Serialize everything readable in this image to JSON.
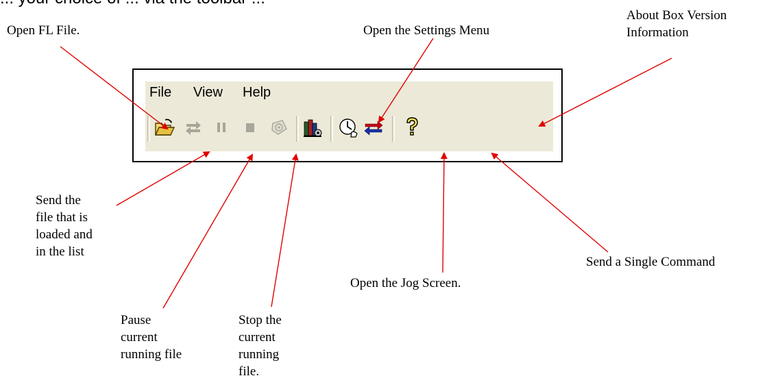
{
  "heading_fragment": "... your choice of ... via the toolbar ...",
  "menu": {
    "file": "File",
    "view": "View",
    "help": "Help"
  },
  "toolbar_buttons": [
    {
      "name": "open-fl-file-button",
      "icon": "open-folder-icon",
      "enabled": true
    },
    {
      "name": "send-file-button",
      "icon": "send-arrows-icon",
      "enabled": false
    },
    {
      "name": "pause-button",
      "icon": "pause-icon",
      "enabled": false
    },
    {
      "name": "stop-button",
      "icon": "stop-icon",
      "enabled": false
    },
    {
      "name": "disabled-tool-button",
      "icon": "gear-disc-icon",
      "enabled": false
    },
    {
      "name": "settings-button",
      "icon": "settings-books-icon",
      "enabled": true
    },
    {
      "name": "jog-screen-button",
      "icon": "jog-hand-icon",
      "enabled": true
    },
    {
      "name": "single-command-button",
      "icon": "swap-arrows-icon",
      "enabled": true
    },
    {
      "name": "about-button",
      "icon": "question-mark-icon",
      "enabled": true
    }
  ],
  "annotations": {
    "open_fl_file": "Open FL File.",
    "settings_menu": "Open the Settings Menu",
    "about_line1": "About Box Version",
    "about_line2": "Information",
    "send_line1": "Send the",
    "send_line2": "file that is",
    "send_line3": "loaded and",
    "send_line4": "in the list",
    "jog_screen": "Open the Jog Screen.",
    "single_command": "Send a Single Command",
    "pause_line1": "Pause",
    "pause_line2": "current",
    "pause_line3": "running file",
    "stop_line1": "Stop the",
    "stop_line2": "current",
    "stop_line3": "running",
    "stop_line4": "file."
  },
  "colors": {
    "arrow": "#e00000",
    "toolbar_bg": "#ece9d8",
    "disabled_icon": "#a8a59a"
  }
}
